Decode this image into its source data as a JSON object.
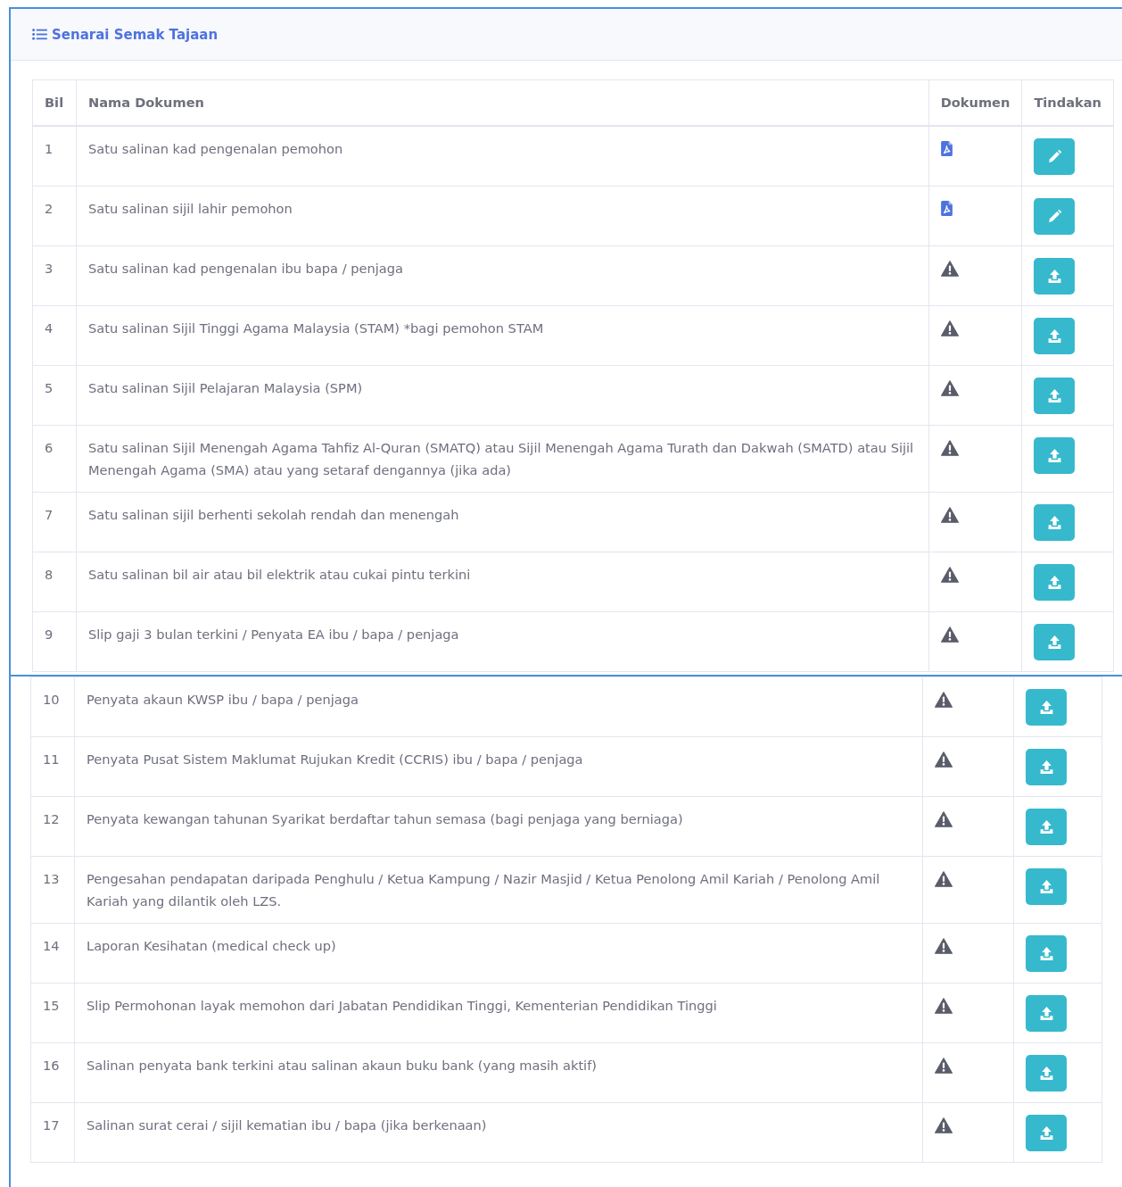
{
  "panel": {
    "title": "Senarai Semak Tajaan"
  },
  "table": {
    "columns": [
      "Bil",
      "Nama Dokumen",
      "Dokumen",
      "Tindakan"
    ],
    "sections": [
      {
        "rows": [
          {
            "number": "1",
            "name": "Satu salinan kad pengenalan pemohon",
            "kind": "uploaded"
          },
          {
            "number": "2",
            "name": "Satu salinan sijil lahir pemohon",
            "kind": "uploaded"
          },
          {
            "number": "3",
            "name": "Satu salinan kad pengenalan ibu bapa / penjaga",
            "kind": "missing"
          },
          {
            "number": "4",
            "name": "Satu salinan Sijil Tinggi Agama Malaysia (STAM) *bagi pemohon STAM",
            "kind": "missing"
          },
          {
            "number": "5",
            "name": "Satu salinan Sijil Pelajaran Malaysia (SPM)",
            "kind": "missing"
          },
          {
            "number": "6",
            "name": "Satu salinan Sijil Menengah Agama Tahfiz Al-Quran (SMATQ) atau Sijil Menengah Agama Turath dan Dakwah (SMATD) atau Sijil Menengah Agama (SMA) atau yang setaraf dengannya (jika ada)",
            "kind": "missing"
          },
          {
            "number": "7",
            "name": "Satu salinan sijil berhenti sekolah rendah dan menengah",
            "kind": "missing"
          },
          {
            "number": "8",
            "name": "Satu salinan bil air atau bil elektrik atau cukai pintu terkini",
            "kind": "missing"
          },
          {
            "number": "9",
            "name": "Slip gaji 3 bulan terkini / Penyata EA ibu / bapa / penjaga",
            "kind": "missing"
          }
        ]
      },
      {
        "rows": [
          {
            "number": "10",
            "name": "Penyata akaun KWSP ibu / bapa / penjaga",
            "kind": "missing"
          },
          {
            "number": "11",
            "name": "Penyata Pusat Sistem Maklumat Rujukan Kredit (CCRIS) ibu / bapa / penjaga",
            "kind": "missing"
          },
          {
            "number": "12",
            "name": "Penyata kewangan tahunan Syarikat berdaftar tahun semasa (bagi penjaga yang berniaga)",
            "kind": "missing"
          },
          {
            "number": "13",
            "name": "Pengesahan pendapatan daripada Penghulu / Ketua Kampung / Nazir Masjid / Ketua Penolong Amil Kariah / Penolong Amil Kariah yang dilantik oleh LZS.",
            "kind": "missing"
          },
          {
            "number": "14",
            "name": "Laporan Kesihatan (medical check up)",
            "kind": "missing"
          },
          {
            "number": "15",
            "name": "Slip Permohonan layak memohon dari Jabatan Pendidikan Tinggi, Kementerian Pendidikan Tinggi",
            "kind": "missing"
          },
          {
            "number": "16",
            "name": "Salinan penyata bank terkini atau salinan akaun buku bank (yang masih aktif)",
            "kind": "missing"
          },
          {
            "number": "17",
            "name": "Salinan surat cerai / sijil kematian ibu / bapa (jika berkenaan)",
            "kind": "missing"
          }
        ]
      }
    ]
  }
}
